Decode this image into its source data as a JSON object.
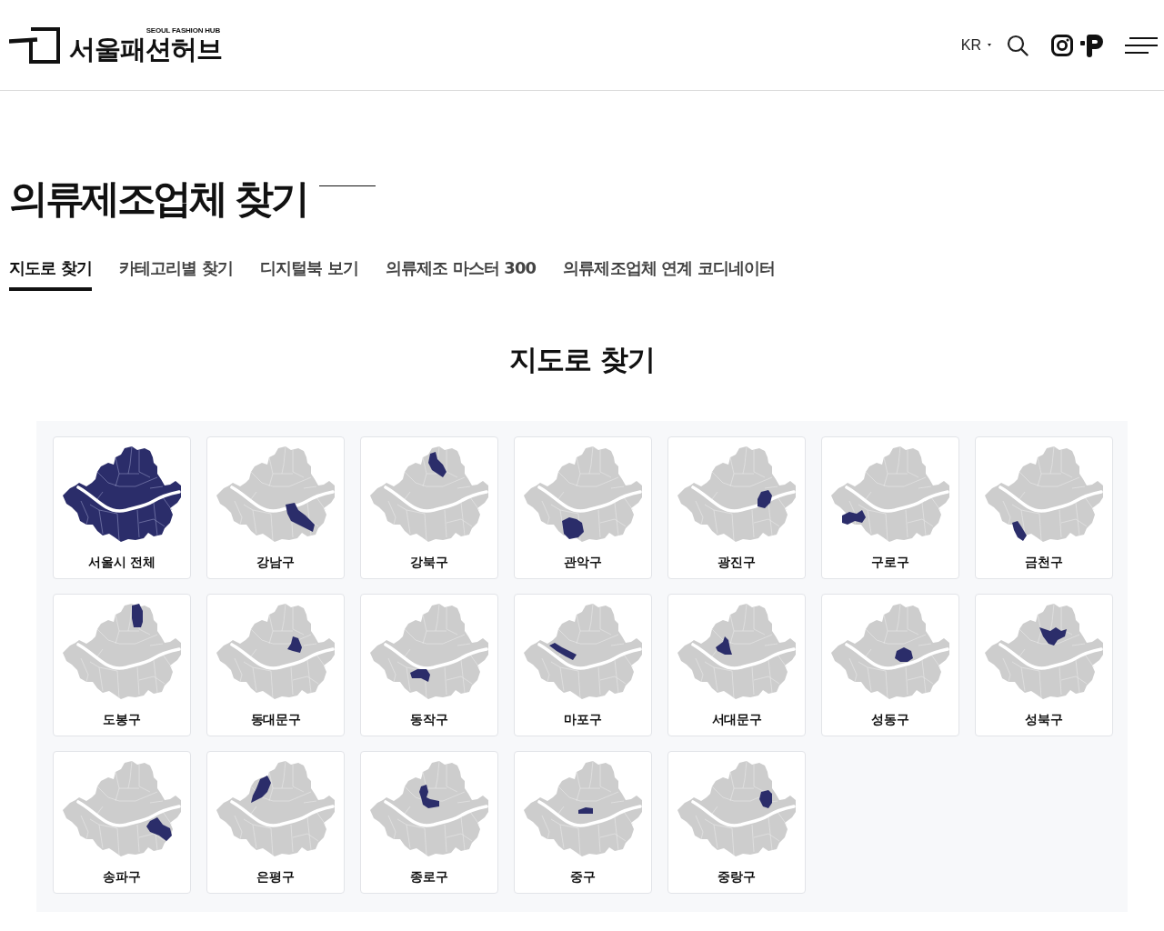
{
  "header": {
    "logo": {
      "tagline": "SEOUL FASHION HUB",
      "wordmark": "서울패션허브"
    },
    "language": "KR"
  },
  "page_title": "의류제조업체 찾기",
  "tabs": [
    {
      "label": "지도로 찾기",
      "selected": true
    },
    {
      "label": "카테고리별 찾기",
      "selected": false
    },
    {
      "label": "디지털북 보기",
      "selected": false
    },
    {
      "label": "의류제조 마스터 300",
      "selected": false
    },
    {
      "label": "의류제조업체 연계 코디네이터",
      "selected": false
    }
  ],
  "section_title": "지도로 찾기",
  "districts": [
    {
      "label": "서울시 전체",
      "kind": "city"
    },
    {
      "label": "강남구",
      "kind": "district"
    },
    {
      "label": "강북구",
      "kind": "district"
    },
    {
      "label": "관악구",
      "kind": "district"
    },
    {
      "label": "광진구",
      "kind": "district"
    },
    {
      "label": "구로구",
      "kind": "district"
    },
    {
      "label": "금천구",
      "kind": "district"
    },
    {
      "label": "도봉구",
      "kind": "district"
    },
    {
      "label": "동대문구",
      "kind": "district"
    },
    {
      "label": "동작구",
      "kind": "district"
    },
    {
      "label": "마포구",
      "kind": "district"
    },
    {
      "label": "서대문구",
      "kind": "district"
    },
    {
      "label": "성동구",
      "kind": "district"
    },
    {
      "label": "성북구",
      "kind": "district"
    },
    {
      "label": "송파구",
      "kind": "district"
    },
    {
      "label": "은평구",
      "kind": "district"
    },
    {
      "label": "종로구",
      "kind": "district"
    },
    {
      "label": "중구",
      "kind": "district"
    },
    {
      "label": "중랑구",
      "kind": "district"
    }
  ]
}
